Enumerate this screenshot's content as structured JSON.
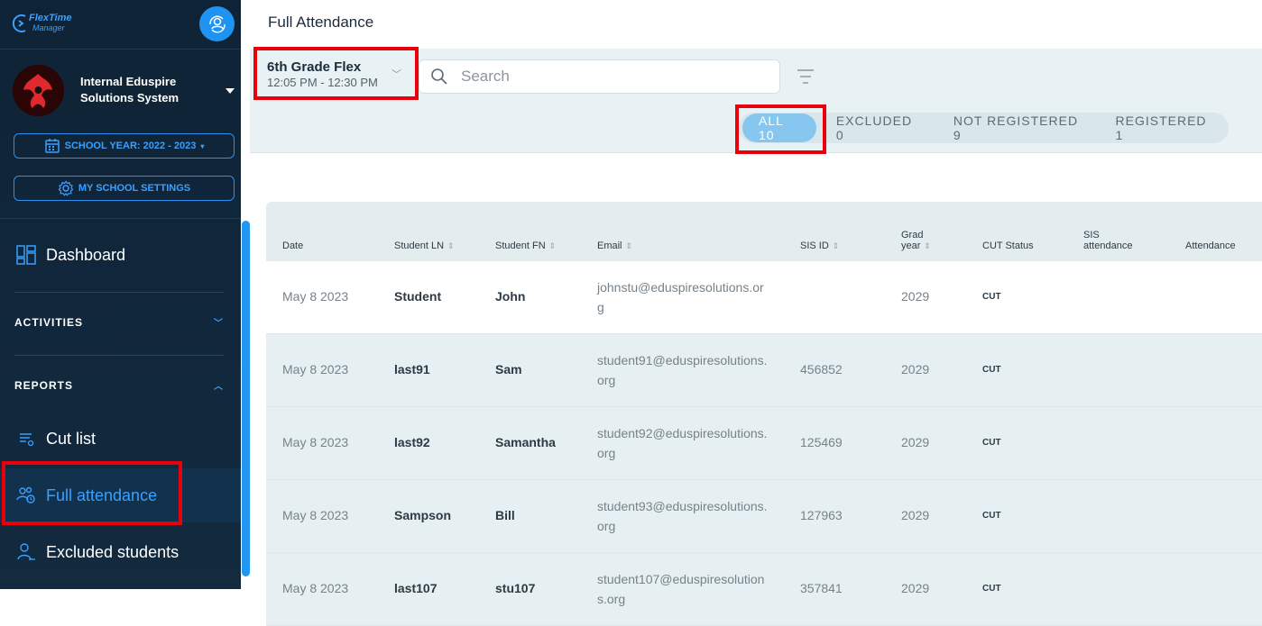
{
  "app": {
    "logo_line1": "FlexTime",
    "logo_line2": "Manager"
  },
  "org": {
    "name": "Internal Eduspire Solutions System"
  },
  "sidebar": {
    "school_year_label": "SCHOOL YEAR: 2022 - 2023",
    "school_settings_label": "MY SCHOOL SETTINGS",
    "dashboard_label": "Dashboard",
    "activities_label": "ACTIVITIES",
    "reports_label": "REPORTS",
    "items": [
      {
        "label": "Cut list"
      },
      {
        "label": "Full attendance"
      },
      {
        "label": "Excluded students"
      }
    ]
  },
  "page": {
    "title": "Full Attendance"
  },
  "toolbar": {
    "flex_name": "6th Grade Flex",
    "flex_time": "12:05 PM - 12:30 PM",
    "search_placeholder": "Search"
  },
  "tabs": [
    {
      "label": "ALL 10"
    },
    {
      "label": "EXCLUDED 0"
    },
    {
      "label": "NOT REGISTERED 9"
    },
    {
      "label": "REGISTERED 1"
    }
  ],
  "table": {
    "headers": {
      "date": "Date",
      "ln": "Student LN",
      "fn": "Student FN",
      "email": "Email",
      "sis_id": "SIS ID",
      "grad_line1": "Grad",
      "grad_line2": "year",
      "cut_status": "CUT Status",
      "sis_att_line1": "SIS",
      "sis_att_line2": "attendance",
      "attendance": "Attendance"
    },
    "rows": [
      {
        "date": "May 8 2023",
        "ln": "Student",
        "fn": "John",
        "email": "johnstu@eduspiresolutions.org",
        "sis_id": "",
        "grad": "2029",
        "cut": "CUT"
      },
      {
        "date": "May 8 2023",
        "ln": "last91",
        "fn": "Sam",
        "email": "student91@eduspiresolutions.org",
        "sis_id": "456852",
        "grad": "2029",
        "cut": "CUT"
      },
      {
        "date": "May 8 2023",
        "ln": "last92",
        "fn": "Samantha",
        "email": "student92@eduspiresolutions.org",
        "sis_id": "125469",
        "grad": "2029",
        "cut": "CUT"
      },
      {
        "date": "May 8 2023",
        "ln": "Sampson",
        "fn": "Bill",
        "email": "student93@eduspiresolutions.org",
        "sis_id": "127963",
        "grad": "2029",
        "cut": "CUT"
      },
      {
        "date": "May 8 2023",
        "ln": "last107",
        "fn": "stu107",
        "email": "student107@eduspiresolutions.org",
        "sis_id": "357841",
        "grad": "2029",
        "cut": "CUT"
      }
    ]
  },
  "colors": {
    "accent": "#2196f3",
    "sidebar_bg": "#0f2336",
    "highlight": "#e8000b",
    "tab_active": "#87c7ef"
  }
}
